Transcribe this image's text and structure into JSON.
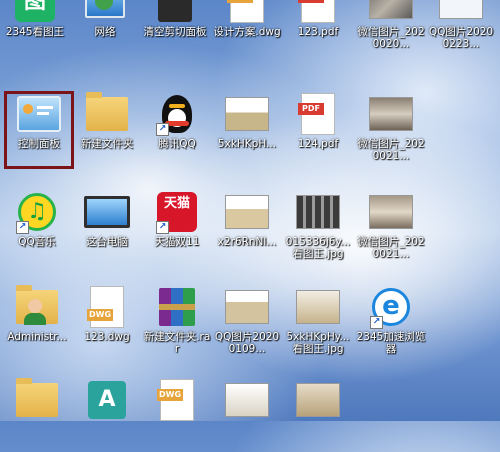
{
  "desktop": {
    "colors": {
      "selection_border": "#7a1418",
      "label_text": "#ffffff",
      "pdf_red": "#d83b2f",
      "dwg_orange": "#e7a43a"
    },
    "icons": [
      {
        "label": "2345看图王",
        "icon": "2345-viewer-icon"
      },
      {
        "label": "网络",
        "icon": "network-icon"
      },
      {
        "label": "清空剪切面板",
        "icon": "clear-clipboard-icon"
      },
      {
        "label": "设计方案.dwg",
        "icon": "dwg-file-icon"
      },
      {
        "label": "123.pdf",
        "icon": "pdf-file-icon"
      },
      {
        "label": "微信图片_2020020...",
        "icon": "image-file-icon"
      },
      {
        "label": "QQ图片20200223...",
        "icon": "image-file-icon"
      },
      {
        "label": "控制面板",
        "icon": "control-panel-icon"
      },
      {
        "label": "新建文件夹",
        "icon": "folder-icon"
      },
      {
        "label": "腾讯QQ",
        "icon": "qq-penguin-icon"
      },
      {
        "label": "5xkHKpH...",
        "icon": "image-file-icon"
      },
      {
        "label": "124.pdf",
        "icon": "pdf-file-icon"
      },
      {
        "label": "微信图片_2020021...",
        "icon": "image-file-icon"
      },
      {
        "label": "QQ音乐",
        "icon": "qq-music-icon"
      },
      {
        "label": "这台电脑",
        "icon": "this-pc-icon"
      },
      {
        "label": "天猫双11",
        "icon": "tmall-icon"
      },
      {
        "label": "x2r6RnNl...",
        "icon": "image-file-icon"
      },
      {
        "label": "015336j6y...看图王.jpg",
        "icon": "image-file-icon"
      },
      {
        "label": "微信图片_2020021...",
        "icon": "image-file-icon"
      },
      {
        "label": "Administr...",
        "icon": "user-folder-icon"
      },
      {
        "label": "123.dwg",
        "icon": "dwg-file-icon"
      },
      {
        "label": "新建文件夹.rar",
        "icon": "rar-archive-icon"
      },
      {
        "label": "QQ图片20200109...",
        "icon": "image-file-icon"
      },
      {
        "label": "5xkHKpHy...看图王.jpg",
        "icon": "image-file-icon"
      },
      {
        "label": "2345加速浏览器",
        "icon": "2345-browser-icon"
      }
    ],
    "badges": {
      "dwg": "DWG",
      "pdf": "PDF",
      "tmall_title": "天猫",
      "qq_music_note": "♫",
      "browser_e": "e",
      "viewer_char": "图",
      "archive_a": "A"
    }
  }
}
